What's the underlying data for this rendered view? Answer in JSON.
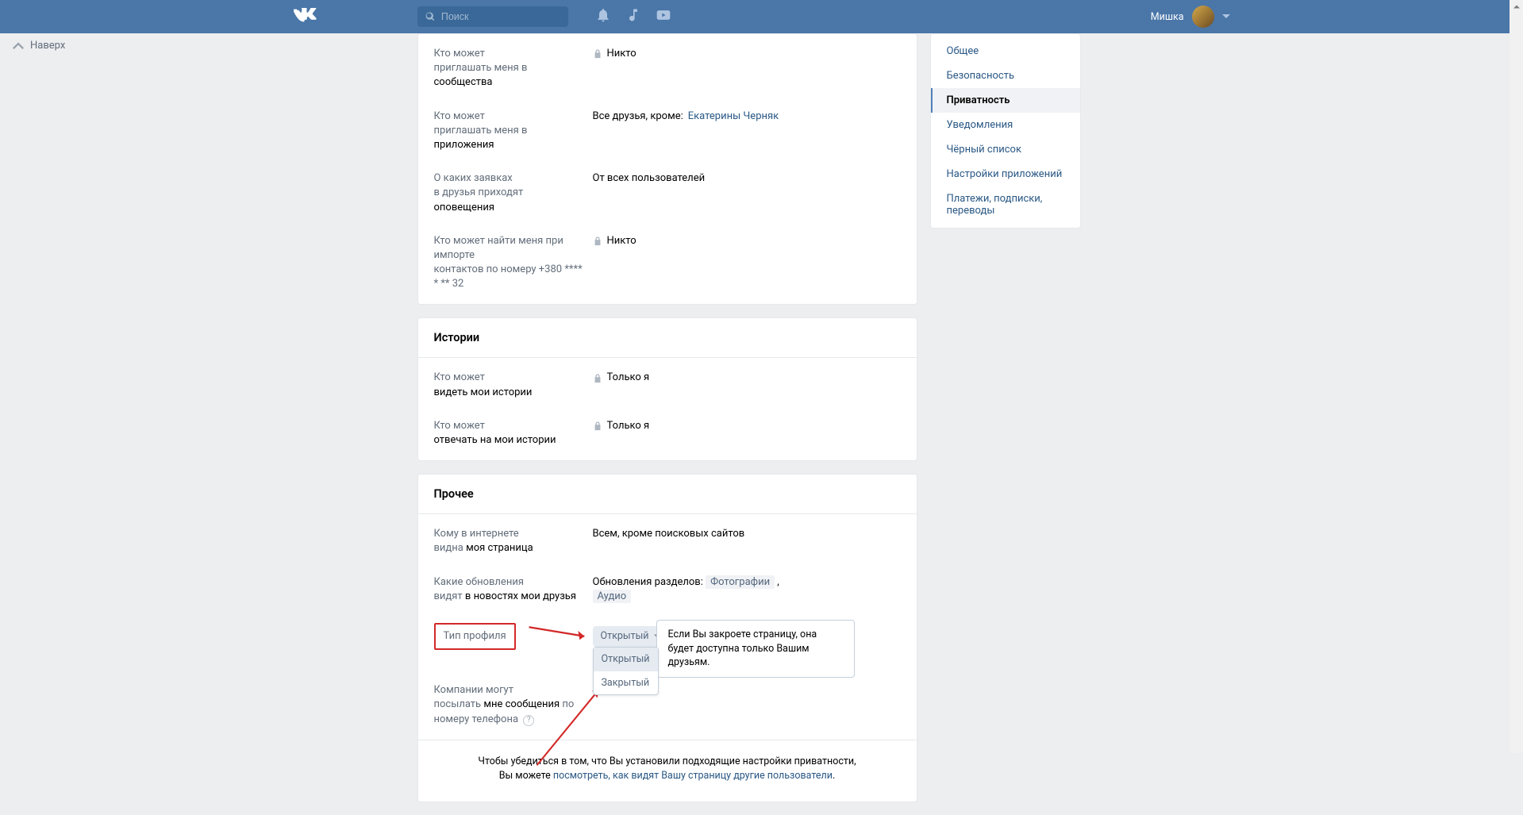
{
  "header": {
    "search_placeholder": "Поиск",
    "username": "Мишка"
  },
  "back_top": "Наверх",
  "sections": {
    "invites": [
      {
        "label_line1": "Кто может",
        "label_line2_a": "приглашать меня в ",
        "label_line2_b": "сообщества",
        "value_prefix_lock": true,
        "value": "Никто"
      },
      {
        "label_line1": "Кто может",
        "label_line2_a": "приглашать меня в ",
        "label_line2_b": "приложения",
        "value": "Все друзья, кроме:",
        "value_link": "Екатерины Черняк"
      },
      {
        "label_line1": "О каких заявках",
        "label_line2_a": "в друзья приходят ",
        "label_line2_b": "оповещения",
        "value": "От всех пользователей"
      },
      {
        "label_line1": "Кто может найти меня при импорте",
        "label_line2_a": "контактов по номеру +380 **** * ** 32",
        "label_line2_b": "",
        "value_prefix_lock": true,
        "value": "Никто"
      }
    ],
    "stories_header": "Истории",
    "stories": [
      {
        "label_line1": "Кто может",
        "label_line2": "видеть мои истории",
        "value_prefix_lock": true,
        "value": "Только я"
      },
      {
        "label_line1": "Кто может",
        "label_line2": "отвечать на мои истории",
        "value_prefix_lock": true,
        "value": "Только я"
      }
    ],
    "other_header": "Прочее",
    "other": {
      "row1": {
        "label_line1": "Кому в интернете",
        "label_line2_a": "видна ",
        "label_line2_b": "моя страница",
        "value": "Всем, кроме поисковых сайтов"
      },
      "row2": {
        "label_line1": "Какие обновления",
        "label_line2_a": "видят ",
        "label_line2_b": "в новостях мои друзья",
        "value_prefix": "Обновления разделов: ",
        "tag1": "Фотографии",
        "tag2": "Аудио"
      },
      "row3": {
        "label": "Тип профиля",
        "dropdown_value": "Открытый",
        "options": [
          "Открытый",
          "Закрытый"
        ],
        "tooltip": "Если Вы закроете страницу, она будет доступна только Вашим друзьям."
      },
      "row4": {
        "label_line1": "Компании могут",
        "label_line2_a": "посылать ",
        "label_line2_b": "мне сообщения",
        "label_line2_c": " по номеру телефона"
      }
    },
    "footer": {
      "text1": "Чтобы убедиться в том, что Вы установили подходящие настройки приватности,",
      "text2": "Вы можете ",
      "link": "посмотреть, как видят Вашу страницу другие пользователи",
      "text3": "."
    }
  },
  "sidebar": {
    "items": [
      "Общее",
      "Безопасность",
      "Приватность",
      "Уведомления",
      "Чёрный список",
      "Настройки приложений",
      "Платежи, подписки, переводы"
    ],
    "active_index": 2
  }
}
